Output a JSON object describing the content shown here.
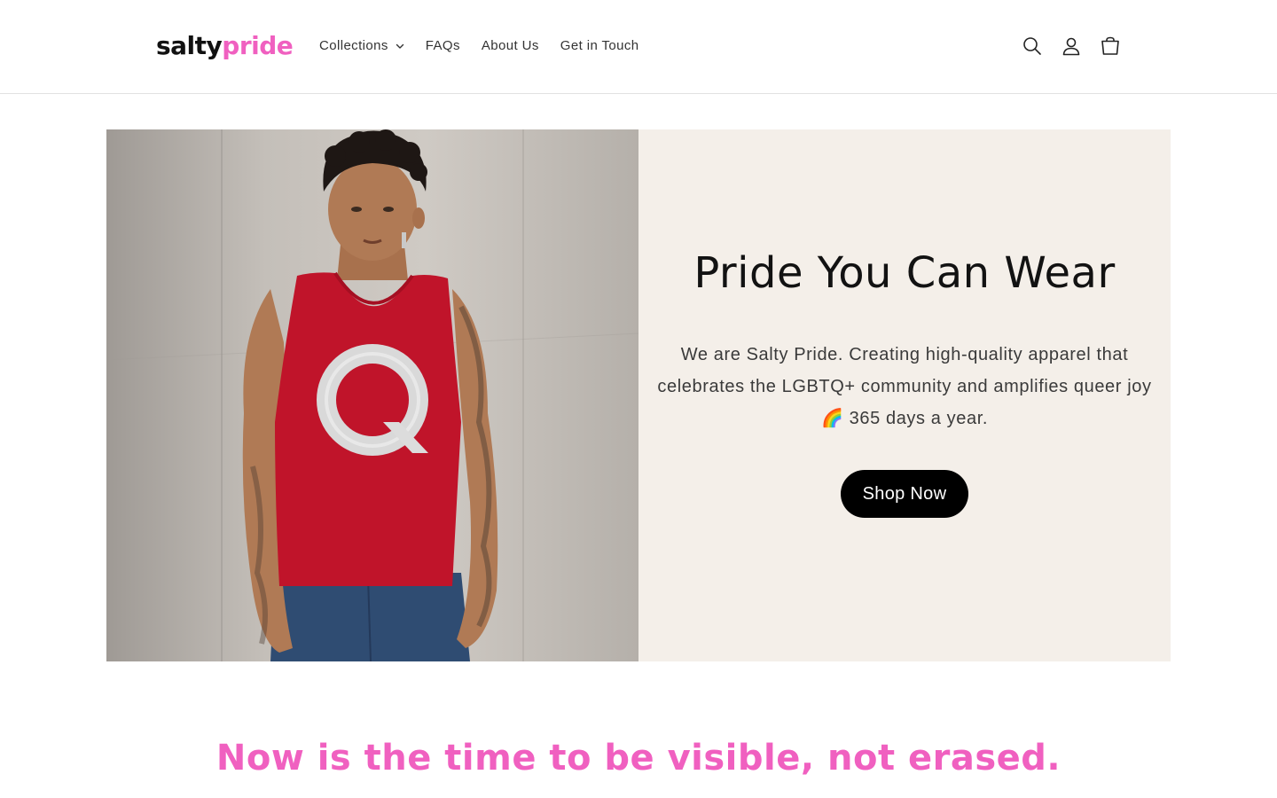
{
  "brand": {
    "logo_part1": "salty",
    "logo_part2": "pride",
    "accent_color": "#f060c0"
  },
  "nav": {
    "items": [
      {
        "label": "Collections",
        "has_dropdown": true
      },
      {
        "label": "FAQs"
      },
      {
        "label": "About Us"
      },
      {
        "label": "Get in Touch"
      }
    ]
  },
  "header_icons": [
    "search-icon",
    "account-icon",
    "cart-icon"
  ],
  "hero": {
    "title": "Pride You Can Wear",
    "subtitle": "We are Salty Pride. Creating high-quality apparel that celebrates the LGBTQ+ community and amplifies queer joy 🌈 365 days a year.",
    "cta_label": "Shop Now",
    "image_shirt_letter": "Q",
    "panel_color": "#f4efe9"
  },
  "tagline": "Now is the time to be visible, not erased."
}
